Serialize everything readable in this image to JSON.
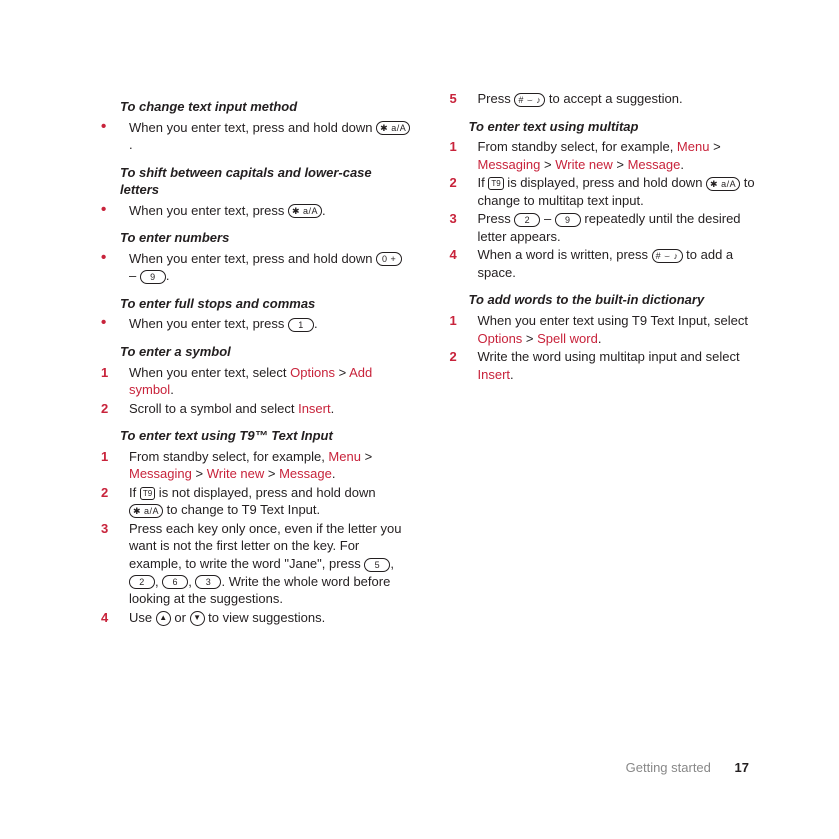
{
  "footer": {
    "section": "Getting started",
    "page": "17"
  },
  "keys": {
    "star": "✱ a/A",
    "zero": "0 +",
    "one": "1",
    "two": "2",
    "three": "3",
    "five": "5",
    "six": "6",
    "nine": "9",
    "hash": "# ⌣ ♪",
    "up": "▲",
    "down": "▼",
    "t9": "T9"
  },
  "col1": {
    "s1": {
      "title": "To change text input method",
      "t1a": "When you enter text, press and hold down ",
      "t1b": "."
    },
    "s2": {
      "title": "To shift between capitals and lower-case letters",
      "t1a": "When you enter text, press ",
      "t1b": "."
    },
    "s3": {
      "title": "To enter numbers",
      "t1a": "When you enter text, press and hold down ",
      "t1b": " – ",
      "t1c": "."
    },
    "s4": {
      "title": "To enter full stops and commas",
      "t1a": "When you enter text, press ",
      "t1b": "."
    },
    "s5": {
      "title": "To enter a symbol",
      "t1a": "When you enter text, select ",
      "t1opt": "Options",
      "t1gt": " > ",
      "t1add": "Add symbol",
      "t1end": ".",
      "t2a": "Scroll to a symbol and select ",
      "t2ins": "Insert",
      "t2end": "."
    },
    "s6": {
      "title": "To enter text using T9™ Text Input",
      "t1a": "From standby select, for example, ",
      "t1menu": "Menu",
      "gt": " > ",
      "t1msg": "Messaging",
      "t1wn": "Write new",
      "t1m": "Message",
      "t1end": ".",
      "t2a": "If ",
      "t2b": " is not displayed, press and hold down ",
      "t2c": " to change to T9 Text Input.",
      "t3a": "Press each key only once, even if the letter you want is not the first letter on the key. For example, to write the word \"Jane\", press ",
      "t3b": ", ",
      "t3c": ", ",
      "t3d": ", ",
      "t3e": ". Write the whole word before looking at the suggestions.",
      "t4a": "Use ",
      "t4b": " or ",
      "t4c": " to view suggestions."
    }
  },
  "col2": {
    "s6": {
      "t5a": "Press ",
      "t5b": " to accept a suggestion."
    },
    "s7": {
      "title": "To enter text using multitap",
      "t1a": "From standby select, for example, ",
      "t1menu": "Menu",
      "gt": " > ",
      "t1msg": "Messaging",
      "t1wn": "Write new",
      "t1m": "Message",
      "t1end": ".",
      "t2a": "If ",
      "t2b": " is displayed, press and hold down ",
      "t2c": " to change to multitap text input.",
      "t3a": "Press ",
      "t3b": " – ",
      "t3c": " repeatedly until the desired letter appears.",
      "t4a": "When a word is written, press ",
      "t4b": " to add a space."
    },
    "s8": {
      "title": "To add words to the built-in dictionary",
      "t1a": "When you enter text using T9 Text Input, select ",
      "t1opt": "Options",
      "gt": " > ",
      "t1sw": "Spell word",
      "t1end": ".",
      "t2a": "Write the word using multitap input and select ",
      "t2ins": "Insert",
      "t2end": "."
    }
  }
}
